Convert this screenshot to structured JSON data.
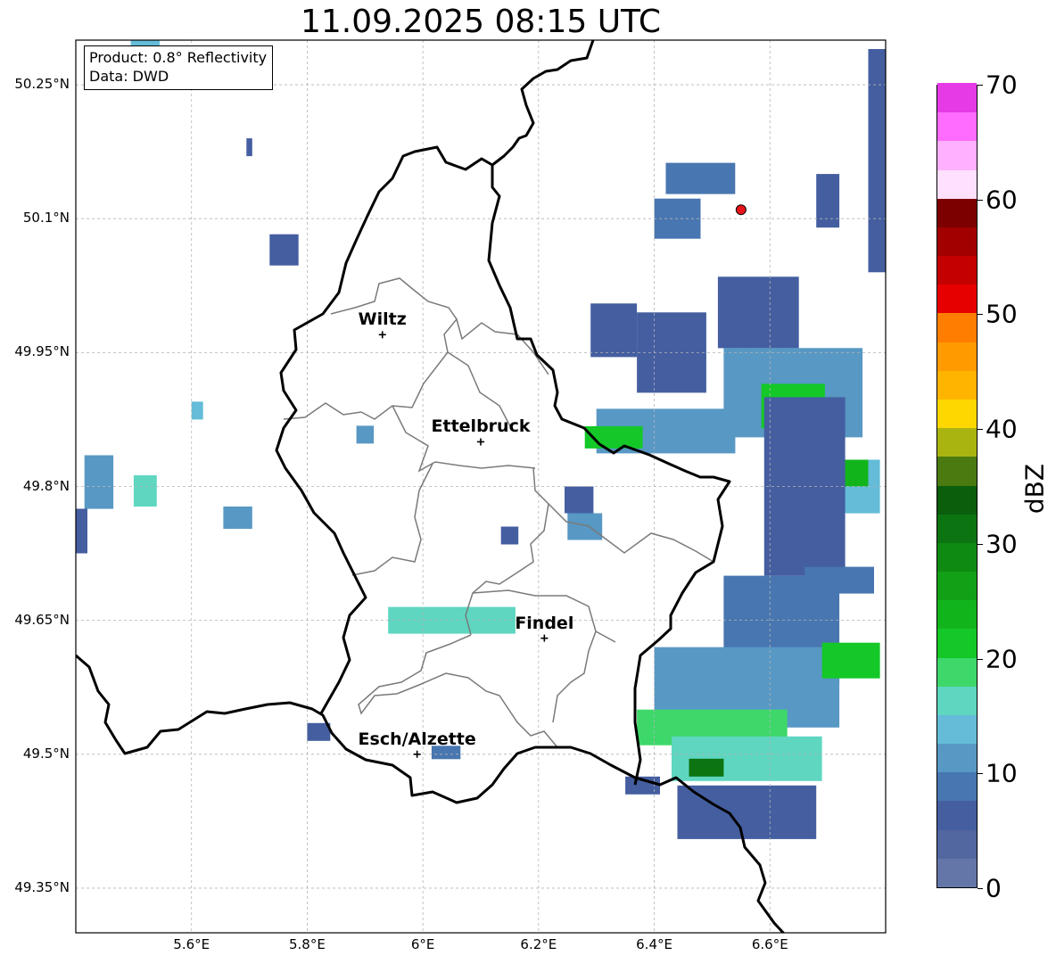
{
  "title": "11.09.2025 08:15 UTC",
  "info": {
    "product": "Product: 0.8° Reflectivity",
    "source": "Data: DWD"
  },
  "map": {
    "lon_range": [
      5.4,
      6.8
    ],
    "lat_range": [
      49.3,
      50.3
    ],
    "grid": true,
    "lon_ticks": [
      {
        "value": 5.6,
        "label": "5.6°E"
      },
      {
        "value": 5.8,
        "label": "5.8°E"
      },
      {
        "value": 6.0,
        "label": "6°E"
      },
      {
        "value": 6.2,
        "label": "6.2°E"
      },
      {
        "value": 6.4,
        "label": "6.4°E"
      },
      {
        "value": 6.6,
        "label": "6.6°E"
      }
    ],
    "lat_ticks": [
      {
        "value": 49.35,
        "label": "49.35°N"
      },
      {
        "value": 49.5,
        "label": "49.5°N"
      },
      {
        "value": 49.65,
        "label": "49.65°N"
      },
      {
        "value": 49.8,
        "label": "49.8°N"
      },
      {
        "value": 49.95,
        "label": "49.95°N"
      },
      {
        "value": 50.1,
        "label": "50.1°N"
      },
      {
        "value": 50.25,
        "label": "50.25°N"
      }
    ],
    "cities": [
      {
        "name": "Wiltz",
        "lon": 5.93,
        "lat": 49.97
      },
      {
        "name": "Ettelbruck",
        "lon": 6.1,
        "lat": 49.85
      },
      {
        "name": "Findel",
        "lon": 6.21,
        "lat": 49.63
      },
      {
        "name": "Esch/Alzette",
        "lon": 5.99,
        "lat": 49.5
      }
    ],
    "radar_site": {
      "lon": 6.55,
      "lat": 50.11,
      "color": "#e8141a"
    }
  },
  "colorbar": {
    "label": "dBZ",
    "min": 0,
    "max": 70,
    "ticks": [
      {
        "value": 0,
        "label": "0"
      },
      {
        "value": 10,
        "label": "10"
      },
      {
        "value": 20,
        "label": "20"
      },
      {
        "value": 30,
        "label": "30"
      },
      {
        "value": 40,
        "label": "40"
      },
      {
        "value": 50,
        "label": "50"
      },
      {
        "value": 60,
        "label": "60"
      },
      {
        "value": 70,
        "label": "70"
      }
    ],
    "colors": [
      "#6475a8",
      "#52669f",
      "#445ea0",
      "#4876b0",
      "#5898c4",
      "#64bcd8",
      "#5ed6c0",
      "#3ed86a",
      "#14c828",
      "#12b41c",
      "#11a016",
      "#0e8a12",
      "#0c7410",
      "#0a5e0c",
      "#4a7a10",
      "#aab410",
      "#ffd700",
      "#ffb400",
      "#ff9a00",
      "#ff7d00",
      "#e60000",
      "#c40000",
      "#a20000",
      "#7c0000",
      "#ffe0ff",
      "#ffb0ff",
      "#ff6cff",
      "#e63ae6"
    ]
  },
  "echoes": [
    {
      "lon": 5.52,
      "lat": 50.295,
      "w": 0.05,
      "h": 0.01,
      "dbz": 14
    },
    {
      "lon": 5.7,
      "lat": 50.18,
      "w": 0.01,
      "h": 0.02,
      "dbz": 5
    },
    {
      "lon": 5.76,
      "lat": 50.065,
      "w": 0.05,
      "h": 0.035,
      "dbz": 5
    },
    {
      "lon": 5.61,
      "lat": 49.885,
      "w": 0.02,
      "h": 0.02,
      "dbz": 14
    },
    {
      "lon": 5.9,
      "lat": 49.858,
      "w": 0.03,
      "h": 0.02,
      "dbz": 10
    },
    {
      "lon": 5.44,
      "lat": 49.805,
      "w": 0.05,
      "h": 0.06,
      "dbz": 10
    },
    {
      "lon": 5.52,
      "lat": 49.795,
      "w": 0.04,
      "h": 0.035,
      "dbz": 16
    },
    {
      "lon": 5.41,
      "lat": 49.75,
      "w": 0.02,
      "h": 0.05,
      "dbz": 6
    },
    {
      "lon": 5.68,
      "lat": 49.765,
      "w": 0.05,
      "h": 0.025,
      "dbz": 11
    },
    {
      "lon": 6.05,
      "lat": 49.65,
      "w": 0.22,
      "h": 0.03,
      "dbz": 16
    },
    {
      "lon": 6.15,
      "lat": 49.745,
      "w": 0.03,
      "h": 0.02,
      "dbz": 6
    },
    {
      "lon": 6.27,
      "lat": 49.785,
      "w": 0.05,
      "h": 0.03,
      "dbz": 6
    },
    {
      "lon": 6.28,
      "lat": 49.755,
      "w": 0.06,
      "h": 0.03,
      "dbz": 10
    },
    {
      "lon": 5.82,
      "lat": 49.525,
      "w": 0.04,
      "h": 0.02,
      "dbz": 5
    },
    {
      "lon": 6.04,
      "lat": 49.502,
      "w": 0.05,
      "h": 0.015,
      "dbz": 9
    },
    {
      "lon": 6.33,
      "lat": 49.975,
      "w": 0.08,
      "h": 0.06,
      "dbz": 5
    },
    {
      "lon": 6.43,
      "lat": 49.95,
      "w": 0.12,
      "h": 0.09,
      "dbz": 7
    },
    {
      "lon": 6.58,
      "lat": 49.995,
      "w": 0.14,
      "h": 0.08,
      "dbz": 5
    },
    {
      "lon": 6.64,
      "lat": 49.905,
      "w": 0.24,
      "h": 0.1,
      "dbz": 11
    },
    {
      "lon": 6.64,
      "lat": 49.89,
      "w": 0.11,
      "h": 0.05,
      "dbz": 22
    },
    {
      "lon": 6.42,
      "lat": 49.862,
      "w": 0.24,
      "h": 0.05,
      "dbz": 10
    },
    {
      "lon": 6.33,
      "lat": 49.855,
      "w": 0.1,
      "h": 0.025,
      "dbz": 22
    },
    {
      "lon": 6.74,
      "lat": 49.8,
      "w": 0.1,
      "h": 0.06,
      "dbz": 13
    },
    {
      "lon": 6.74,
      "lat": 49.815,
      "w": 0.06,
      "h": 0.03,
      "dbz": 24
    },
    {
      "lon": 6.48,
      "lat": 50.145,
      "w": 0.12,
      "h": 0.035,
      "dbz": 9
    },
    {
      "lon": 6.44,
      "lat": 50.1,
      "w": 0.08,
      "h": 0.045,
      "dbz": 9
    },
    {
      "lon": 6.79,
      "lat": 50.165,
      "w": 0.04,
      "h": 0.25,
      "dbz": 5
    },
    {
      "lon": 6.7,
      "lat": 50.12,
      "w": 0.04,
      "h": 0.06,
      "dbz": 5
    },
    {
      "lon": 6.66,
      "lat": 49.8,
      "w": 0.14,
      "h": 0.2,
      "dbz": 5
    },
    {
      "lon": 6.62,
      "lat": 49.64,
      "w": 0.2,
      "h": 0.12,
      "dbz": 8
    },
    {
      "lon": 6.56,
      "lat": 49.575,
      "w": 0.32,
      "h": 0.09,
      "dbz": 12
    },
    {
      "lon": 6.5,
      "lat": 49.53,
      "w": 0.26,
      "h": 0.04,
      "dbz": 18
    },
    {
      "lon": 6.56,
      "lat": 49.495,
      "w": 0.26,
      "h": 0.05,
      "dbz": 16
    },
    {
      "lon": 6.49,
      "lat": 49.485,
      "w": 0.06,
      "h": 0.02,
      "dbz": 32
    },
    {
      "lon": 6.56,
      "lat": 49.435,
      "w": 0.24,
      "h": 0.06,
      "dbz": 7
    },
    {
      "lon": 6.74,
      "lat": 49.605,
      "w": 0.1,
      "h": 0.04,
      "dbz": 21
    },
    {
      "lon": 6.72,
      "lat": 49.695,
      "w": 0.12,
      "h": 0.03,
      "dbz": 8
    },
    {
      "lon": 6.38,
      "lat": 49.465,
      "w": 0.06,
      "h": 0.02,
      "dbz": 6
    }
  ]
}
